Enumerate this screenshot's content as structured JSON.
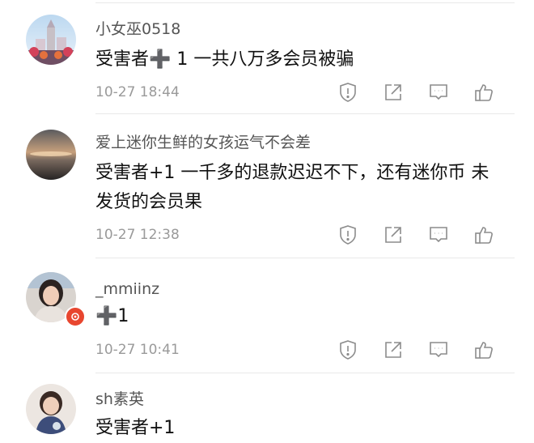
{
  "comments": [
    {
      "username": "小女巫0518",
      "text": "受害者➕ 1 一共八万多会员被骗",
      "time": "10-27 18:44"
    },
    {
      "username": "爱上迷你生鲜的女孩运气不会差",
      "text": "受害者+1 一千多的退款迟迟不下，还有迷你币 未发货的会员果",
      "time": "10-27 12:38"
    },
    {
      "username": "_mmiinz",
      "text": "➕1",
      "time": "10-27 10:41"
    },
    {
      "username": "sh素英",
      "text": "受害者+1",
      "time": ""
    }
  ],
  "icons": {
    "report": "exclamation-shield-icon",
    "share": "share-arrow-icon",
    "reply": "comment-bubble-icon",
    "like": "thumbs-up-icon"
  },
  "colors": {
    "meta_text": "#9a9a9a",
    "username_text": "#555555",
    "icon_stroke": "#8c8c8c",
    "badge": "#e8462f"
  }
}
